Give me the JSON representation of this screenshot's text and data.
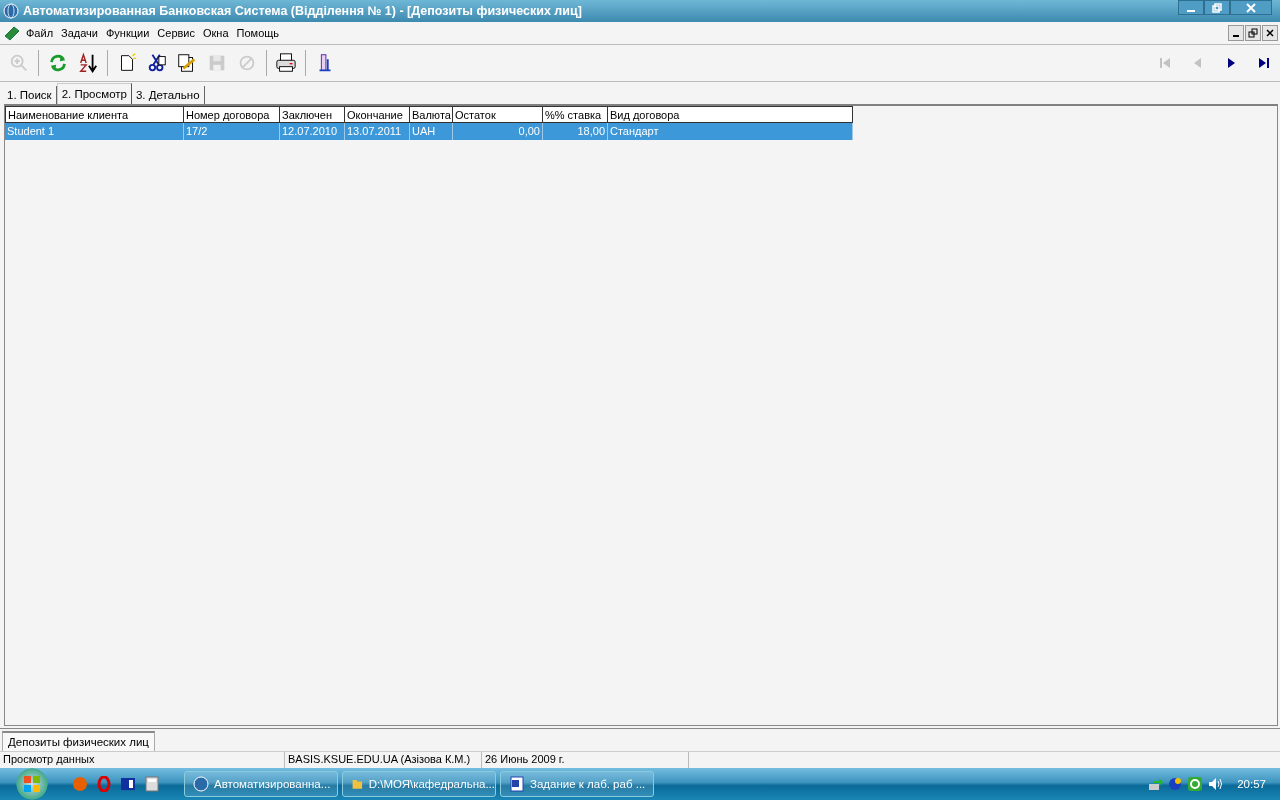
{
  "window": {
    "title": "Автоматизированная Банковская Система (Відділення № 1) - [Депозиты физических лиц]"
  },
  "menu": [
    "Файл",
    "Задачи",
    "Функции",
    "Сервис",
    "Окна",
    "Помощь"
  ],
  "toolbar": [
    {
      "kind": "zoom",
      "disabled": true
    },
    {
      "kind": "sep"
    },
    {
      "kind": "refresh",
      "disabled": false
    },
    {
      "kind": "sort",
      "disabled": false
    },
    {
      "kind": "sep"
    },
    {
      "kind": "new",
      "disabled": false
    },
    {
      "kind": "cut",
      "disabled": false
    },
    {
      "kind": "edit",
      "disabled": false
    },
    {
      "kind": "save",
      "disabled": true
    },
    {
      "kind": "cancel",
      "disabled": true
    },
    {
      "kind": "sep"
    },
    {
      "kind": "print",
      "disabled": false
    },
    {
      "kind": "sep"
    },
    {
      "kind": "tool",
      "disabled": false
    }
  ],
  "navigation": [
    {
      "kind": "first",
      "disabled": true
    },
    {
      "kind": "prev",
      "disabled": true
    },
    {
      "kind": "next",
      "disabled": false
    },
    {
      "kind": "last",
      "disabled": false
    }
  ],
  "tabs": [
    {
      "label": "1. Поиск",
      "selected": false
    },
    {
      "label": "2. Просмотр",
      "selected": true
    },
    {
      "label": "3. Детально",
      "selected": false
    }
  ],
  "table": {
    "columns": [
      {
        "label": "Наименование клиента",
        "kind": "text"
      },
      {
        "label": "Номер договора",
        "kind": "text"
      },
      {
        "label": "Заключен",
        "kind": "text"
      },
      {
        "label": "Окончание",
        "kind": "text"
      },
      {
        "label": "Валюта",
        "kind": "text"
      },
      {
        "label": "Остаток",
        "kind": "number"
      },
      {
        "label": "%% ставка",
        "kind": "number"
      },
      {
        "label": "Вид договора",
        "kind": "text"
      }
    ],
    "rows": [
      {
        "selected": true,
        "cells": [
          "Student 1",
          "17/2",
          "12.07.2010",
          "13.07.2011",
          "UAH",
          "0,00",
          "18,00",
          "Стандарт"
        ]
      }
    ]
  },
  "window_tabs": [
    {
      "label": "Депозиты физических лиц",
      "selected": true
    }
  ],
  "status_bar": [
    "Просмотр данных",
    "BASIS.KSUE.EDU.UA (Азізова К.М.)",
    "26 Июнь 2009 г."
  ],
  "taskbar": {
    "quick_launch": [
      {
        "kind": "firefox"
      },
      {
        "kind": "opera"
      },
      {
        "kind": "app"
      },
      {
        "kind": "calculator"
      }
    ],
    "tasks": [
      {
        "label": "Автоматизированна...",
        "kind": "globe"
      },
      {
        "label": "D:\\МОЯ\\кафедральна...",
        "kind": "folder"
      },
      {
        "label": "Задание к лаб. раб ...",
        "kind": "word"
      }
    ],
    "tray": [
      {
        "kind": "network"
      },
      {
        "kind": "bluetooth"
      },
      {
        "kind": "green"
      },
      {
        "kind": "volume"
      }
    ],
    "clock": "20:57"
  }
}
